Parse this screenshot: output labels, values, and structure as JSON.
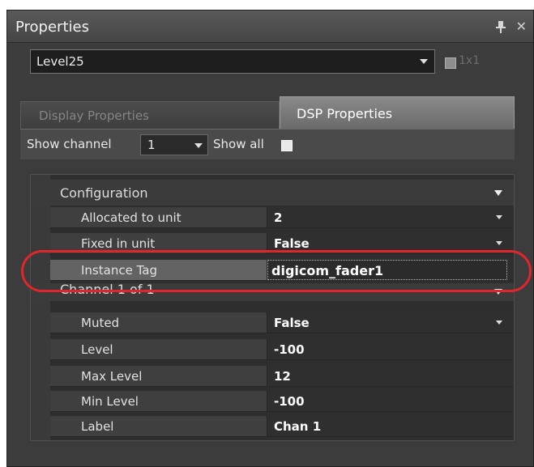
{
  "window": {
    "title": "Properties"
  },
  "selector": {
    "value": "Level25",
    "one_by_one_label": "1x1"
  },
  "tabs": [
    {
      "label": "Display Properties",
      "active": false
    },
    {
      "label": "DSP Properties",
      "active": true
    }
  ],
  "channel_bar": {
    "show_channel_label": "Show channel",
    "channel_value": "1",
    "show_all_label": "Show all"
  },
  "grid": {
    "configuration": {
      "label": "Configuration",
      "rows": [
        {
          "name": "Allocated to unit",
          "value": "2"
        },
        {
          "name": "Fixed in unit",
          "value": "False"
        },
        {
          "name": "Instance Tag",
          "value": "digicom_fader1"
        }
      ]
    },
    "channel": {
      "label": "Channel 1 of 1",
      "rows": [
        {
          "name": "Muted",
          "value": "False"
        },
        {
          "name": "Level",
          "value": "-100"
        },
        {
          "name": "Max Level",
          "value": "12"
        },
        {
          "name": "Min Level",
          "value": "-100"
        },
        {
          "name": "Label",
          "value": "Chan 1"
        }
      ]
    }
  },
  "colors": {
    "highlight": "#e0262c",
    "panel_bg": "#3c3c3c"
  }
}
